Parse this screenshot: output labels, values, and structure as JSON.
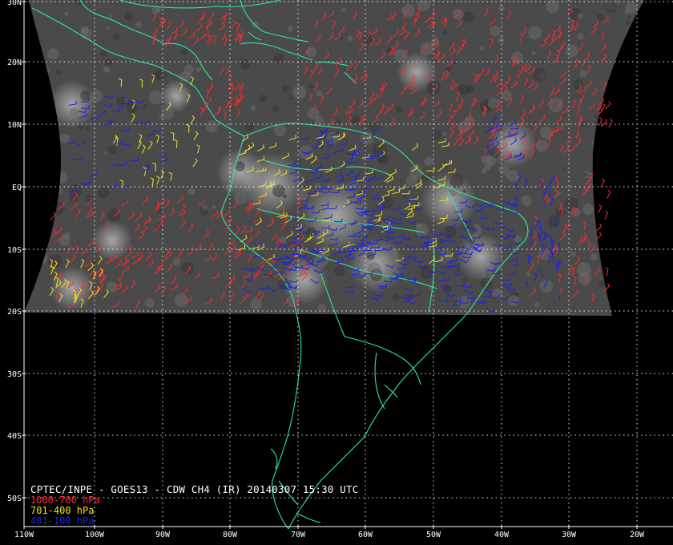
{
  "title": "CPTEC/INPE - GOES13 - CDW CH4 (IR) 20140307 15:30 UTC",
  "legend": [
    {
      "label": "1000-700 hPa",
      "color": "#ff2a2a"
    },
    {
      "label": "701-400 hPa",
      "color": "#f2e21a"
    },
    {
      "label": "401-100 hPa",
      "color": "#1a22e6"
    }
  ],
  "lat_labels": [
    "30N",
    "20N",
    "10N",
    "EQ",
    "10S",
    "20S",
    "30S",
    "40S",
    "50S"
  ],
  "lon_labels": [
    "110W",
    "100W",
    "90W",
    "80W",
    "70W",
    "60W",
    "50W",
    "40W",
    "30W",
    "20W"
  ],
  "colors": {
    "coast": "#2ee8a0",
    "grid": "#ffffff",
    "background": "#000000"
  }
}
